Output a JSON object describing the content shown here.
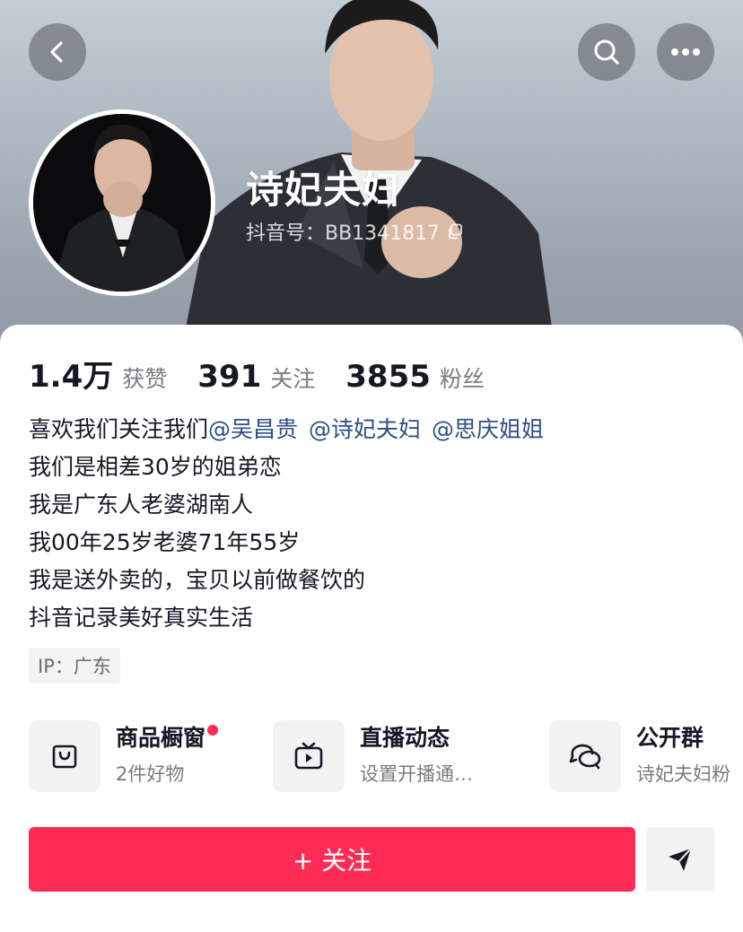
{
  "header": {
    "nickname": "诗妃夫妇",
    "douyin_id": "抖音号：BB1341817",
    "icons": {
      "back": "back-arrow-icon",
      "search": "search-icon",
      "more": "more-dots-icon",
      "copy": "copy-icon"
    }
  },
  "stats": [
    {
      "value": "1.4万",
      "label": "获赞"
    },
    {
      "value": "391",
      "label": "关注"
    },
    {
      "value": "3855",
      "label": "粉丝"
    }
  ],
  "bio": {
    "line1_text": "喜欢我们关注我们",
    "mentions": [
      "@吴昌贵",
      "@诗妃夫妇",
      "@思庆姐姐"
    ],
    "lines": [
      "我们是相差30岁的姐弟恋",
      "我是广东人老婆湖南人",
      "我00年25岁老婆71年55岁",
      "我是送外卖的，宝贝以前做餐饮的",
      "抖音记录美好真实生活"
    ]
  },
  "ip": "IP：广东",
  "features": [
    {
      "title": "商品橱窗",
      "subtitle": "2件好物",
      "icon": "shopping-bag-icon",
      "has_dot": true
    },
    {
      "title": "直播动态",
      "subtitle": "设置开播通…",
      "icon": "tv-live-icon",
      "has_dot": false
    },
    {
      "title": "公开群",
      "subtitle": "诗妃夫妇粉",
      "icon": "chat-bubbles-icon",
      "has_dot": false
    }
  ],
  "actions": {
    "follow_label": "+ 关注",
    "share_icon": "send-arrow-icon"
  },
  "colors": {
    "accent": "#fe2c55",
    "mention": "#2d4f86",
    "secondary_text": "#7a7b80"
  }
}
